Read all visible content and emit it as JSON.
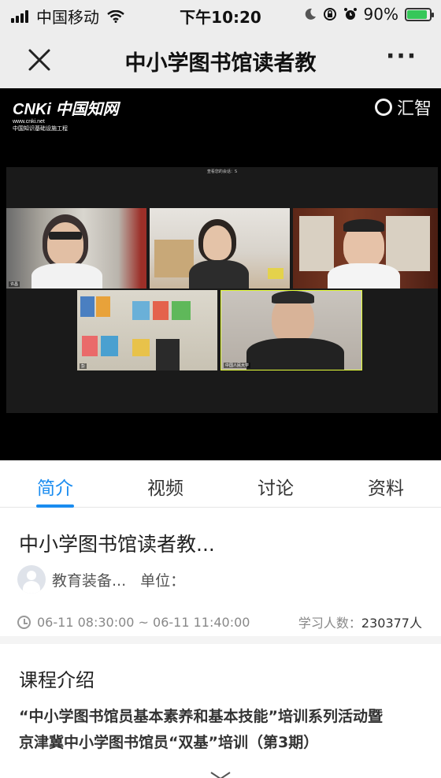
{
  "status_bar": {
    "carrier": "中国移动",
    "time": "下午10:20",
    "battery_percent": "90%",
    "battery_level": 0.9,
    "icons": [
      "signal-icon",
      "wifi-icon",
      "moon-icon",
      "rotation-lock-icon",
      "alarm-icon",
      "battery-icon"
    ]
  },
  "nav": {
    "title": "中小学图书馆读者教",
    "close_icon": "close-icon",
    "more_label": "···"
  },
  "video": {
    "logo_left_main": "CNKi 中国知网",
    "logo_left_url": "www.cnki.net",
    "logo_left_sub": "中国知识基础设施工程",
    "logo_right": "汇智",
    "meeting_top_text": "查看您的会话：S",
    "tile_tags": [
      "许昌",
      "",
      "",
      "彭",
      "中国人民大学"
    ]
  },
  "tabs": [
    {
      "label": "简介",
      "active": true
    },
    {
      "label": "视频",
      "active": false
    },
    {
      "label": "讨论",
      "active": false
    },
    {
      "label": "资料",
      "active": false
    }
  ],
  "course": {
    "title": "中小学图书馆读者教...",
    "author": "教育装备...",
    "unit_label": "单位：",
    "time_range": "06-11 08:30:00 ~ 06-11 11:40:00",
    "learners_label": "学习人数：",
    "learners_count": "230377人"
  },
  "intro": {
    "heading": "课程介绍",
    "line1": "“中小学图书馆员基本素养和基本技能”培训系列活动暨",
    "line2": "京津冀中小学图书馆员“双基”培训（第3期）"
  },
  "colors": {
    "accent": "#1a8cf0",
    "nav_bg": "#ededed",
    "video_bg": "#000000"
  }
}
